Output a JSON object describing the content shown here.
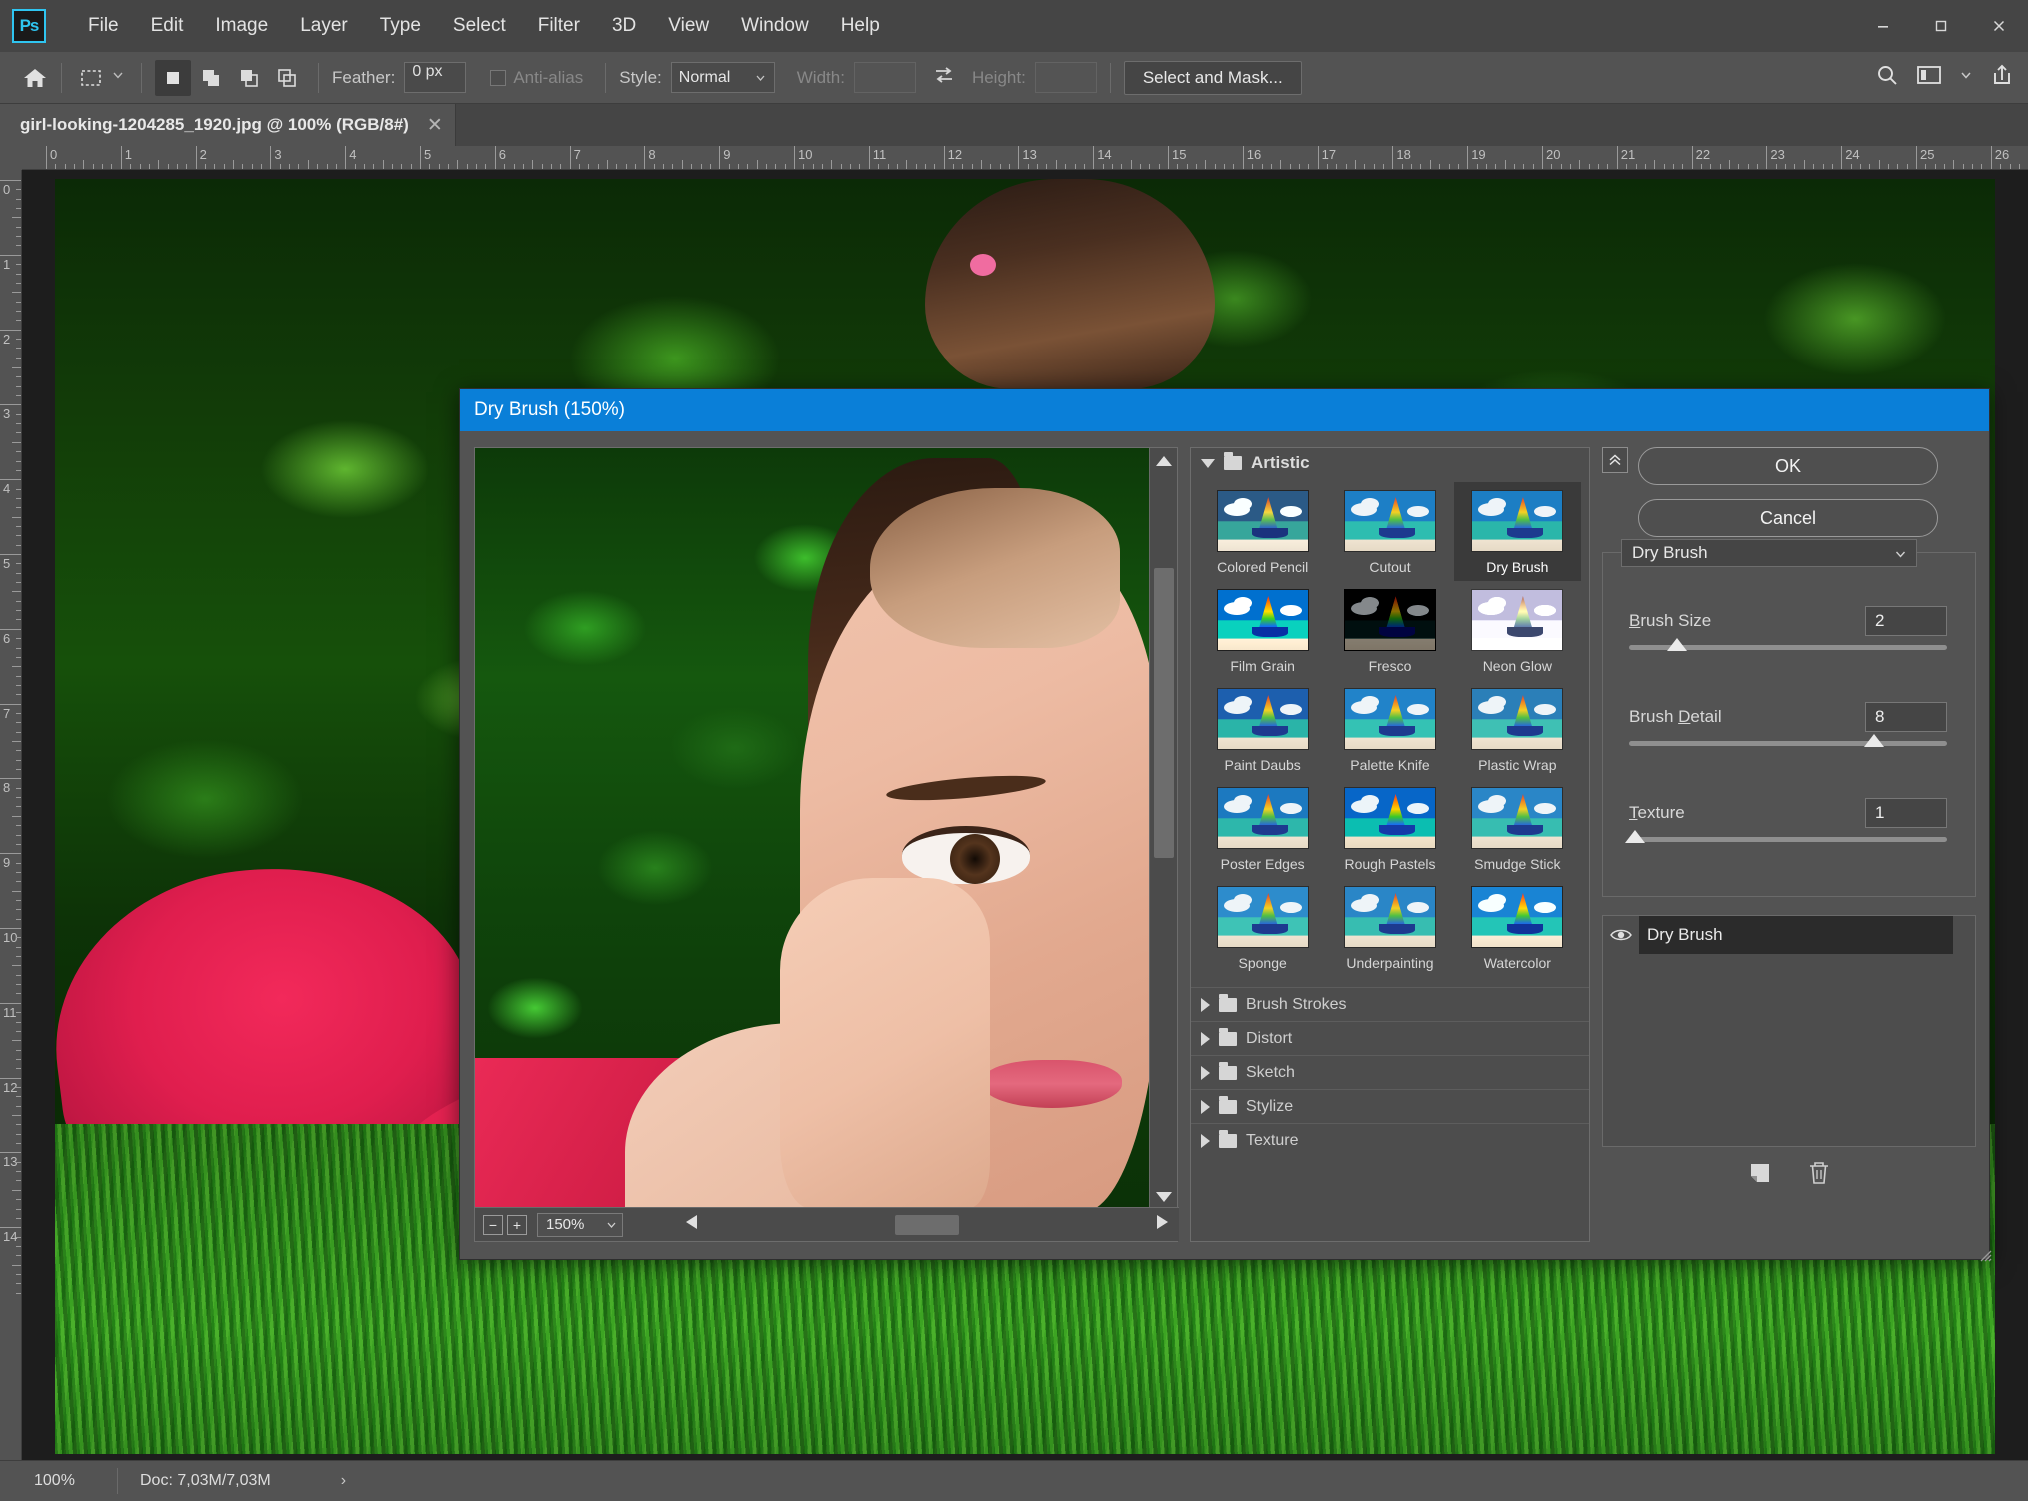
{
  "window": {
    "app_icon_label": "Ps",
    "controls": {
      "minimize": "—",
      "maximize": "▢",
      "close": "✕"
    }
  },
  "menubar": {
    "items": [
      "File",
      "Edit",
      "Image",
      "Layer",
      "Type",
      "Select",
      "Filter",
      "3D",
      "View",
      "Window",
      "Help"
    ]
  },
  "options_bar": {
    "home_icon": "home-icon",
    "tool_icon": "rectangular-marquee-icon",
    "tool_chevron": "chevron-down-icon",
    "selection_modes": [
      "new-selection",
      "add-to-selection",
      "subtract-from-selection",
      "intersect-with-selection"
    ],
    "feather_label": "Feather:",
    "feather_value": "0 px",
    "antialias_label": "Anti-alias",
    "antialias_checked": false,
    "style_label": "Style:",
    "style_value": "Normal",
    "width_label": "Width:",
    "width_value": "",
    "swap_icon": "swap-width-height-icon",
    "height_label": "Height:",
    "height_value": "",
    "select_and_mask_label": "Select and Mask...",
    "right_icons": [
      "search-icon",
      "workspace-icon",
      "chevron-down-icon",
      "share-icon"
    ]
  },
  "document_tab": {
    "title": "girl-looking-1204285_1920.jpg @ 100% (RGB/8#)",
    "close_icon": "✕"
  },
  "rulers": {
    "horizontal_ticks": [
      "0",
      "1",
      "2",
      "3",
      "4",
      "5",
      "6",
      "7",
      "8",
      "9",
      "10",
      "11",
      "12",
      "13",
      "14",
      "15",
      "16",
      "17",
      "18",
      "19",
      "20",
      "21",
      "22",
      "23",
      "24",
      "25",
      "26"
    ],
    "vertical_ticks": [
      "0",
      "1",
      "2",
      "3",
      "4",
      "5",
      "6",
      "7",
      "8",
      "9",
      "10",
      "11",
      "12",
      "13",
      "14"
    ]
  },
  "status_bar": {
    "zoom": "100%",
    "doc_info": "Doc: 7,03M/7,03M",
    "expand_icon": "›"
  },
  "dialog": {
    "title": "Dry Brush (150%)",
    "preview": {
      "zoom_out_icon": "−",
      "zoom_in_icon": "+",
      "zoom_value": "150%",
      "zoom_chevron": "chevron-down-icon",
      "scroll_left_icon": "◀",
      "scroll_right_icon": "▶",
      "scroll_up_icon": "▲",
      "scroll_down_icon": "▼"
    },
    "browser": {
      "expanded_category": "Artistic",
      "filters": [
        {
          "name": "Colored Pencil",
          "selected": false
        },
        {
          "name": "Cutout",
          "selected": false
        },
        {
          "name": "Dry Brush",
          "selected": true
        },
        {
          "name": "Film Grain",
          "selected": false
        },
        {
          "name": "Fresco",
          "selected": false
        },
        {
          "name": "Neon Glow",
          "selected": false
        },
        {
          "name": "Paint Daubs",
          "selected": false
        },
        {
          "name": "Palette Knife",
          "selected": false
        },
        {
          "name": "Plastic Wrap",
          "selected": false
        },
        {
          "name": "Poster Edges",
          "selected": false
        },
        {
          "name": "Rough Pastels",
          "selected": false
        },
        {
          "name": "Smudge Stick",
          "selected": false
        },
        {
          "name": "Sponge",
          "selected": false
        },
        {
          "name": "Underpainting",
          "selected": false
        },
        {
          "name": "Watercolor",
          "selected": false
        }
      ],
      "collapsed_categories": [
        "Brush Strokes",
        "Distort",
        "Sketch",
        "Stylize",
        "Texture"
      ]
    },
    "buttons": {
      "collapse_icon": "collapse-panel-icon",
      "ok": "OK",
      "cancel": "Cancel"
    },
    "filter_select": {
      "value": "Dry Brush",
      "chevron": "chevron-down-icon"
    },
    "params": [
      {
        "label": "Brush Size",
        "underline_char": "B",
        "rest": "rush Size",
        "value": "2",
        "percent": 15
      },
      {
        "label": "Brush Detail",
        "underline_char": "",
        "rest": "Brush Detail",
        "value": "8",
        "percent": 77
      },
      {
        "label": "Texture",
        "underline_char": "T",
        "rest": "exture",
        "value": "1",
        "percent": 2
      }
    ],
    "effect_layers": [
      {
        "name": "Dry Brush",
        "visible": true,
        "visibility_icon": "eye-icon"
      }
    ],
    "layer_tools": [
      "new-effect-layer-icon",
      "delete-effect-layer-icon"
    ],
    "resize_grip_icon": "resize-grip-icon"
  },
  "colors": {
    "title_bar_blue": "#0a7fd8",
    "panel_gray": "#535353",
    "dark_gray": "#454545",
    "accent_cyan": "#2fc5f0"
  }
}
